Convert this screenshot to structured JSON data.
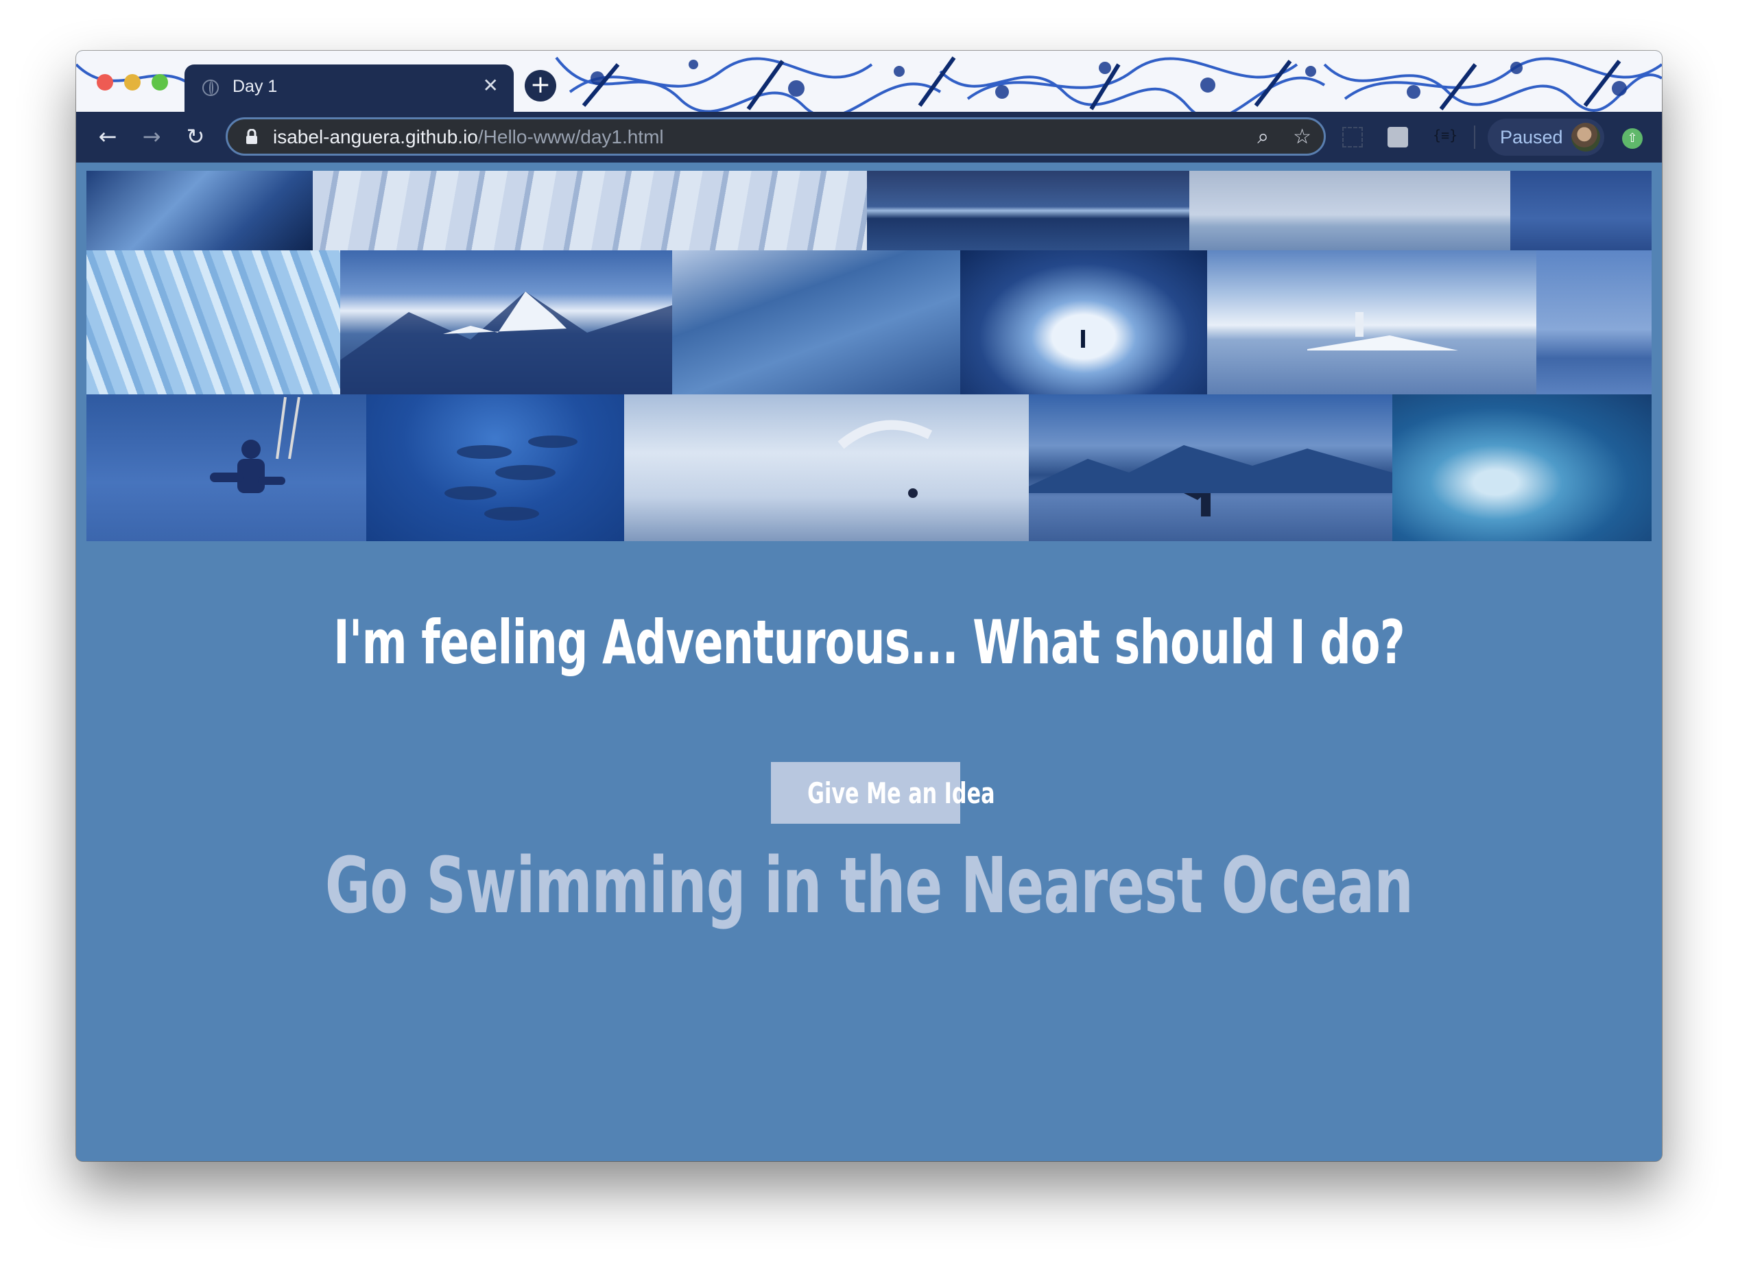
{
  "browser": {
    "tab_title": "Day 1",
    "tab_close_icon": "✕",
    "new_tab_icon": "+",
    "url_host": "isabel-anguera.github.io",
    "url_path": "/Hello-www/day1.html",
    "profile_status": "Paused"
  },
  "page": {
    "headline": "I'm feeling Adventurous... What should I do?",
    "button_label": "Give Me an Idea",
    "suggestion": "Go Swimming in the Nearest Ocean"
  },
  "collage_tiles": [
    {
      "subject": "ice cave wall"
    },
    {
      "subject": "glacier surface"
    },
    {
      "subject": "mountain lake reflection"
    },
    {
      "subject": "glacier lagoon with boat"
    },
    {
      "subject": "misty fjord"
    },
    {
      "subject": "crevassed ice field"
    },
    {
      "subject": "snowy mountain peaks"
    },
    {
      "subject": "frozen glacier river"
    },
    {
      "subject": "person in ice cave"
    },
    {
      "subject": "winter island church on lake"
    },
    {
      "subject": "fjord horizon"
    },
    {
      "subject": "skydiving tandem"
    },
    {
      "subject": "swimming with dolphins"
    },
    {
      "subject": "paragliding over mountains"
    },
    {
      "subject": "whale tail in bay"
    },
    {
      "subject": "surfing wave"
    }
  ],
  "colors": {
    "page_background": "#5383b4",
    "button_background": "#b8c7df",
    "suggestion_text": "#b7c7df",
    "tab_background": "#1d2d52"
  }
}
